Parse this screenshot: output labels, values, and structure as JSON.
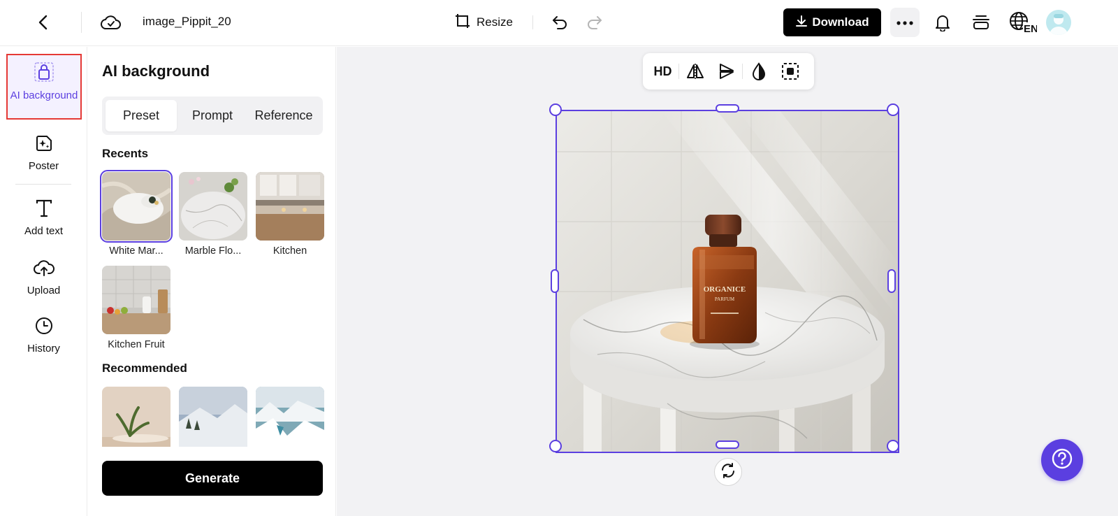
{
  "header": {
    "filename": "image_Pippit_20",
    "resize_label": "Resize",
    "download_label": "Download",
    "language_code": "EN",
    "icons": [
      "back-arrow-icon",
      "cloud-sync-icon",
      "resize-icon",
      "undo-icon",
      "redo-icon",
      "download-icon",
      "more-icon",
      "bell-icon",
      "layers-icon",
      "globe-icon",
      "avatar"
    ]
  },
  "sidebar": {
    "items": [
      {
        "label": "AI background",
        "icon": "shopping-bag-icon",
        "active": true
      },
      {
        "label": "Poster",
        "icon": "poster-icon"
      },
      {
        "label": "Add text",
        "icon": "text-icon"
      },
      {
        "label": "Upload",
        "icon": "upload-cloud-icon"
      },
      {
        "label": "History",
        "icon": "clock-icon"
      }
    ]
  },
  "panel": {
    "title": "AI background",
    "tabs": [
      {
        "label": "Preset",
        "active": true
      },
      {
        "label": "Prompt"
      },
      {
        "label": "Reference"
      }
    ],
    "recents_heading": "Recents",
    "recents": [
      {
        "label": "White Mar...",
        "selected": true
      },
      {
        "label": "Marble Flo..."
      },
      {
        "label": "Kitchen"
      },
      {
        "label": "Kitchen Fruit"
      }
    ],
    "recommended_heading": "Recommended",
    "generate_label": "Generate"
  },
  "canvas": {
    "toolbar": {
      "hd_label": "HD",
      "icons": [
        "flip-horizontal-icon",
        "flip-vertical-icon",
        "opacity-icon",
        "crop-icon"
      ]
    },
    "image_subject": "ORGANICE",
    "bottle_label_line2": "PARFUM"
  },
  "colors": {
    "accent": "#5b3fe0",
    "highlight_border": "#e53935",
    "canvas_bg": "#f2f2f4",
    "primary_button": "#000000"
  }
}
